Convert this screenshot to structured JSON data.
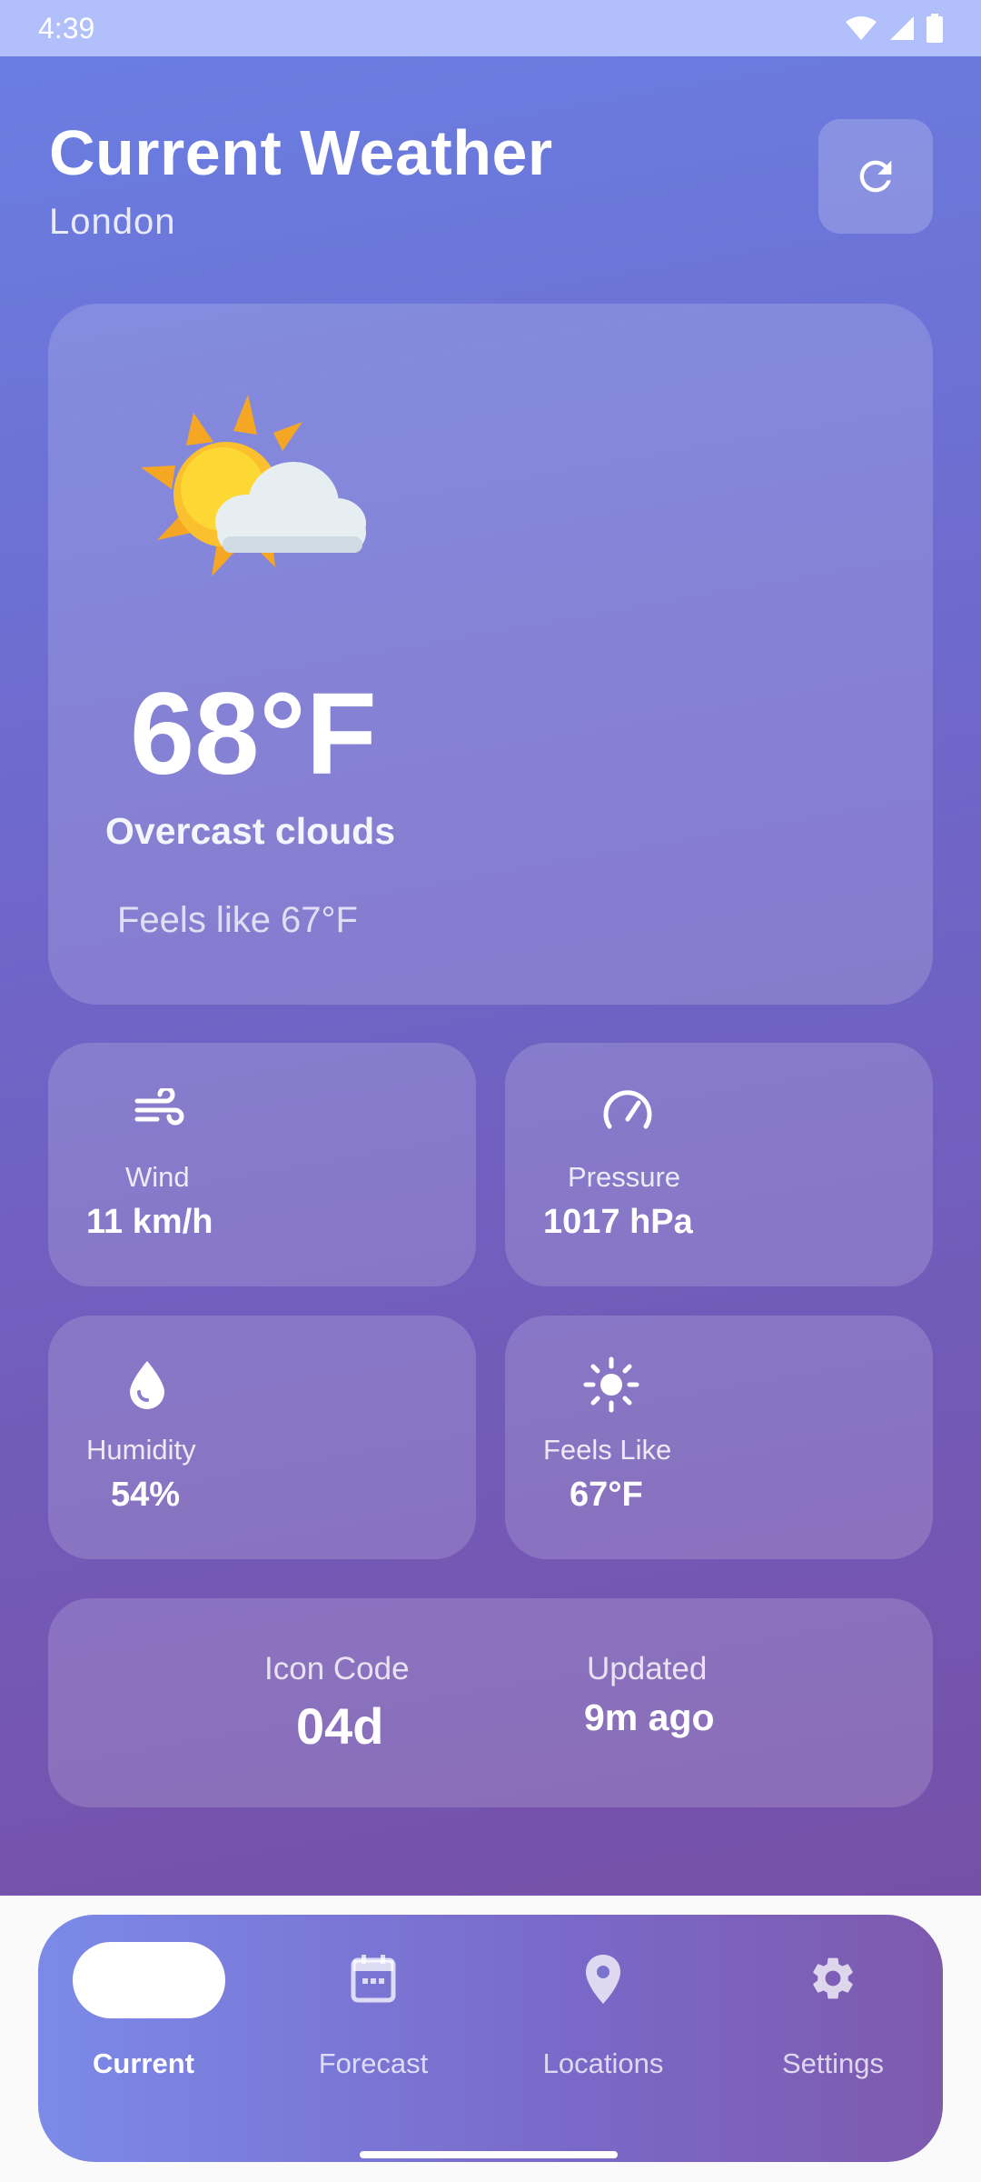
{
  "status_bar": {
    "time": "4:39"
  },
  "header": {
    "title": "Current Weather",
    "city": "London"
  },
  "current": {
    "temperature": "68°F",
    "description": "Overcast clouds",
    "feels_like": "Feels like 67°F",
    "icon": "sun-behind-cloud-icon"
  },
  "metrics": {
    "wind": {
      "label": "Wind",
      "value": "11 km/h",
      "icon": "wind-icon"
    },
    "pressure": {
      "label": "Pressure",
      "value": "1017 hPa",
      "icon": "gauge-icon"
    },
    "humidity": {
      "label": "Humidity",
      "value": "54%",
      "icon": "water-drop-icon"
    },
    "feels_like": {
      "label": "Feels Like",
      "value": "67°F",
      "icon": "sun-icon"
    }
  },
  "info": {
    "icon_code_label": "Icon Code",
    "icon_code_value": "04d",
    "updated_label": "Updated",
    "updated_value": "9m ago"
  },
  "nav": {
    "items": [
      {
        "label": "Current",
        "active": true
      },
      {
        "label": "Forecast",
        "icon": "calendar-icon"
      },
      {
        "label": "Locations",
        "icon": "location-pin-icon"
      },
      {
        "label": "Settings",
        "icon": "gear-icon"
      }
    ]
  },
  "colors": {
    "accent": "#6f66c9",
    "status_bar": "#b1bffb"
  }
}
